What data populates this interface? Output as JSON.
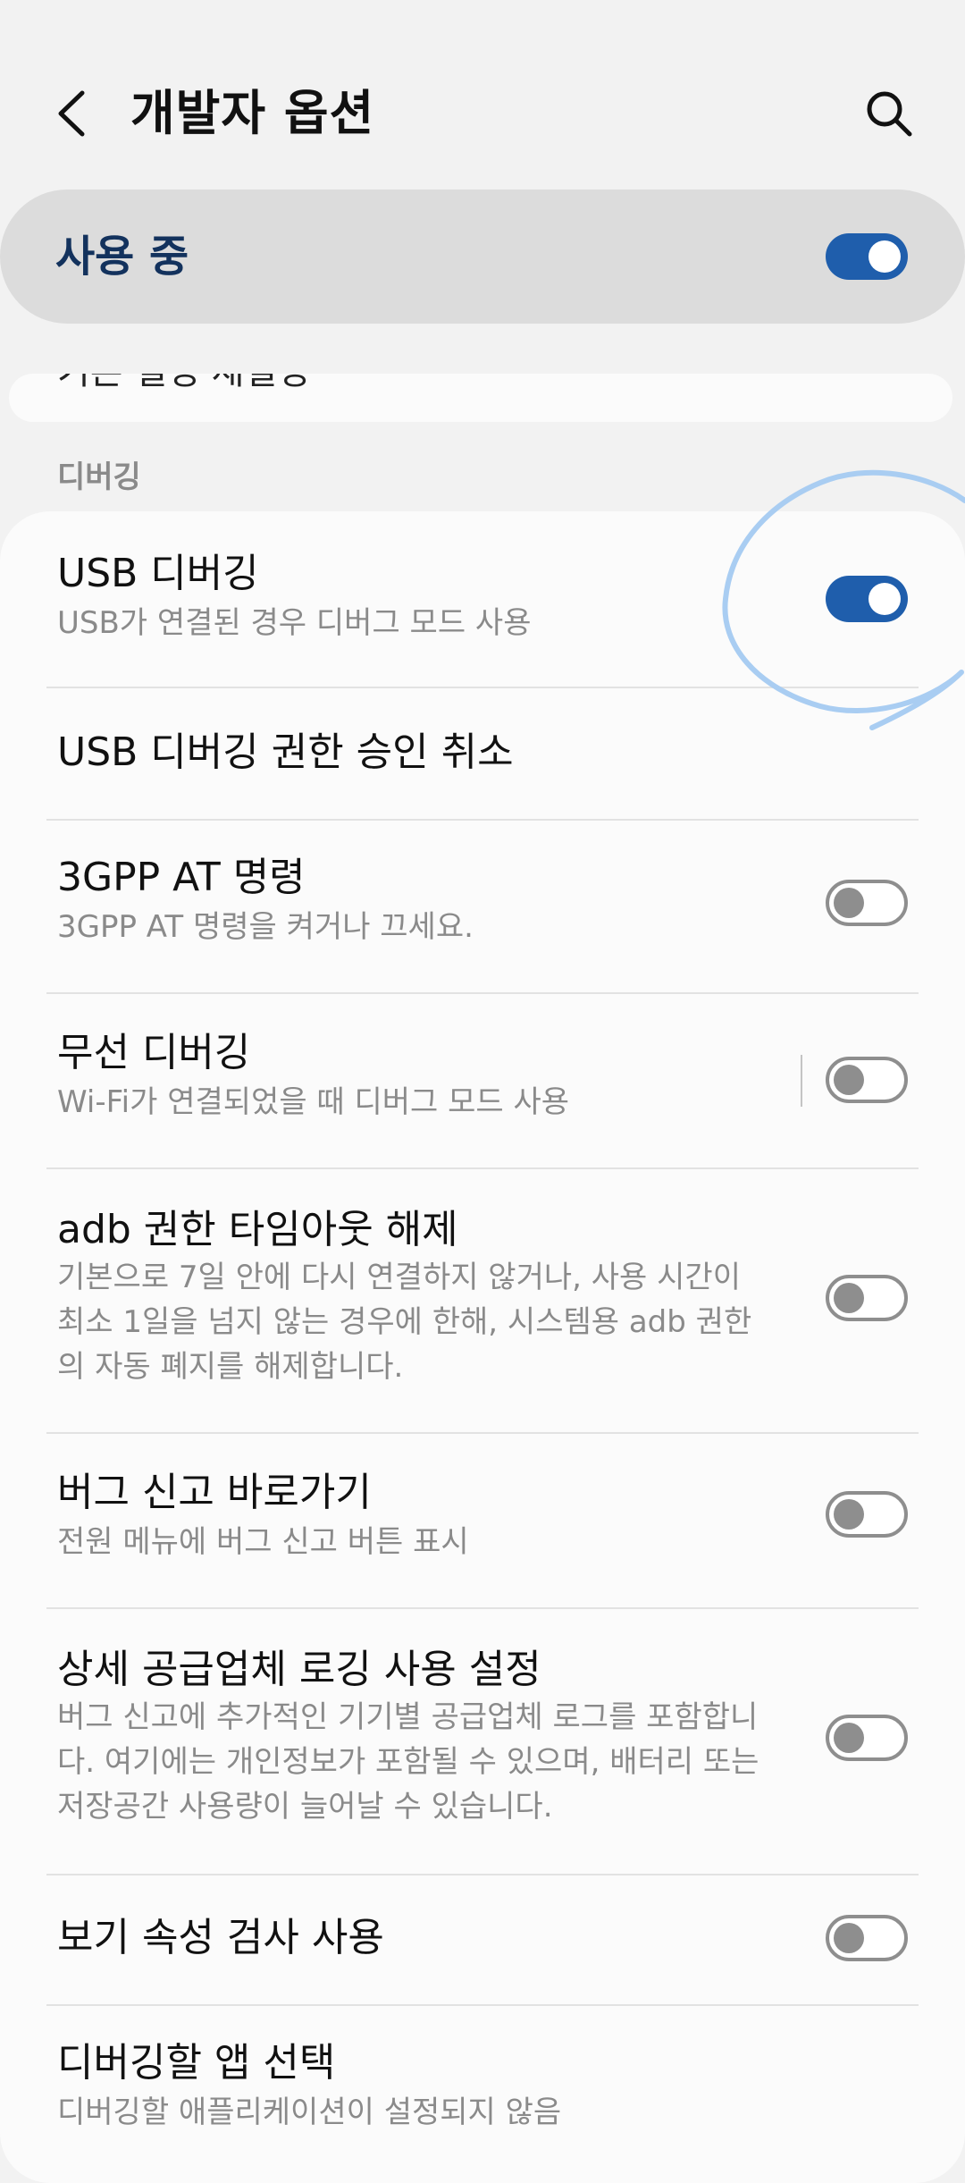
{
  "header": {
    "title": "개발자 옵션",
    "back_icon": "chevron-left-icon",
    "search_icon": "search-icon"
  },
  "master": {
    "label": "사용 중",
    "state": true
  },
  "prev_card": {
    "text": "기본 설정 재설정"
  },
  "section": {
    "label": "디버깅"
  },
  "items": [
    {
      "title": "USB 디버깅",
      "subtitle": "USB가 연결된 경우 디버그 모드 사용",
      "toggle": true
    },
    {
      "title": "USB 디버깅 권한 승인 취소"
    },
    {
      "title": "3GPP AT 명령",
      "subtitle": "3GPP AT 명령을 켜거나 끄세요.",
      "toggle": false
    },
    {
      "title": "무선 디버깅",
      "subtitle": "Wi-Fi가 연결되었을 때 디버그 모드 사용",
      "toggle": false
    },
    {
      "title": "adb 권한 타임아웃 해제",
      "subtitle": "기본으로 7일 안에 다시 연결하지 않거나, 사용 시간이 최소 1일을 넘지 않는 경우에 한해, 시스템용 adb 권한의 자동 폐지를 해제합니다.",
      "toggle": false
    },
    {
      "title": "버그 신고 바로가기",
      "subtitle": "전원 메뉴에 버그 신고 버튼 표시",
      "toggle": false
    },
    {
      "title": "상세 공급업체 로깅 사용 설정",
      "subtitle": "버그 신고에 추가적인 기기별 공급업체 로그를 포함합니다. 여기에는 개인정보가 포함될 수 있으며, 배터리 또는 저장공간 사용량이 늘어날 수 있습니다.",
      "toggle": false
    },
    {
      "title": "보기 속성 검사 사용",
      "toggle": false
    },
    {
      "title": "디버깅할 앱 선택",
      "subtitle": "디버깅할 애플리케이션이 설정되지 않음"
    }
  ],
  "colors": {
    "background": "#f2f2f2",
    "toggle_on": "#1f5eac",
    "toggle_off": "#8e8e8e",
    "master_label": "#13325d",
    "annotation": "#a9cdf2"
  }
}
